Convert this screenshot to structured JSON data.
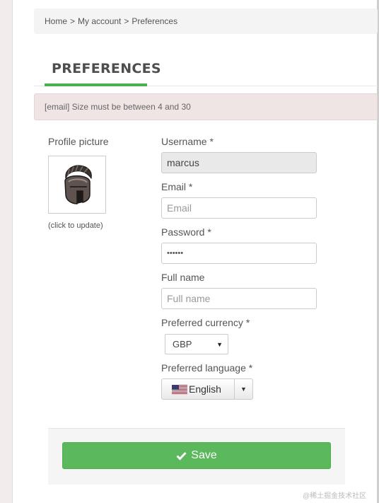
{
  "breadcrumb": {
    "home": "Home",
    "sep1": ">",
    "account": "My account",
    "sep2": ">",
    "current": "Preferences"
  },
  "page": {
    "title": "PREFERENCES"
  },
  "alert": {
    "message": "[email] Size must be between 4 and 30"
  },
  "profile": {
    "label": "Profile picture",
    "hint": "(click to update)",
    "avatar_icon": "spartan-helmet-icon"
  },
  "form": {
    "username": {
      "label": "Username *",
      "value": "marcus"
    },
    "email": {
      "label": "Email *",
      "placeholder": "Email"
    },
    "password": {
      "label": "Password *",
      "value": "••••••"
    },
    "fullname": {
      "label": "Full name",
      "placeholder": "Full name"
    },
    "currency": {
      "label": "Preferred currency *",
      "selected": "GBP"
    },
    "language": {
      "label": "Preferred language *",
      "selected": "English",
      "flag_icon": "us-flag-icon"
    }
  },
  "actions": {
    "save_label": "Save"
  },
  "watermark": "@稀土掘金技术社区",
  "colors": {
    "accent": "#4caf50",
    "save": "#5cb85c",
    "alert_bg": "#efe5e5"
  }
}
